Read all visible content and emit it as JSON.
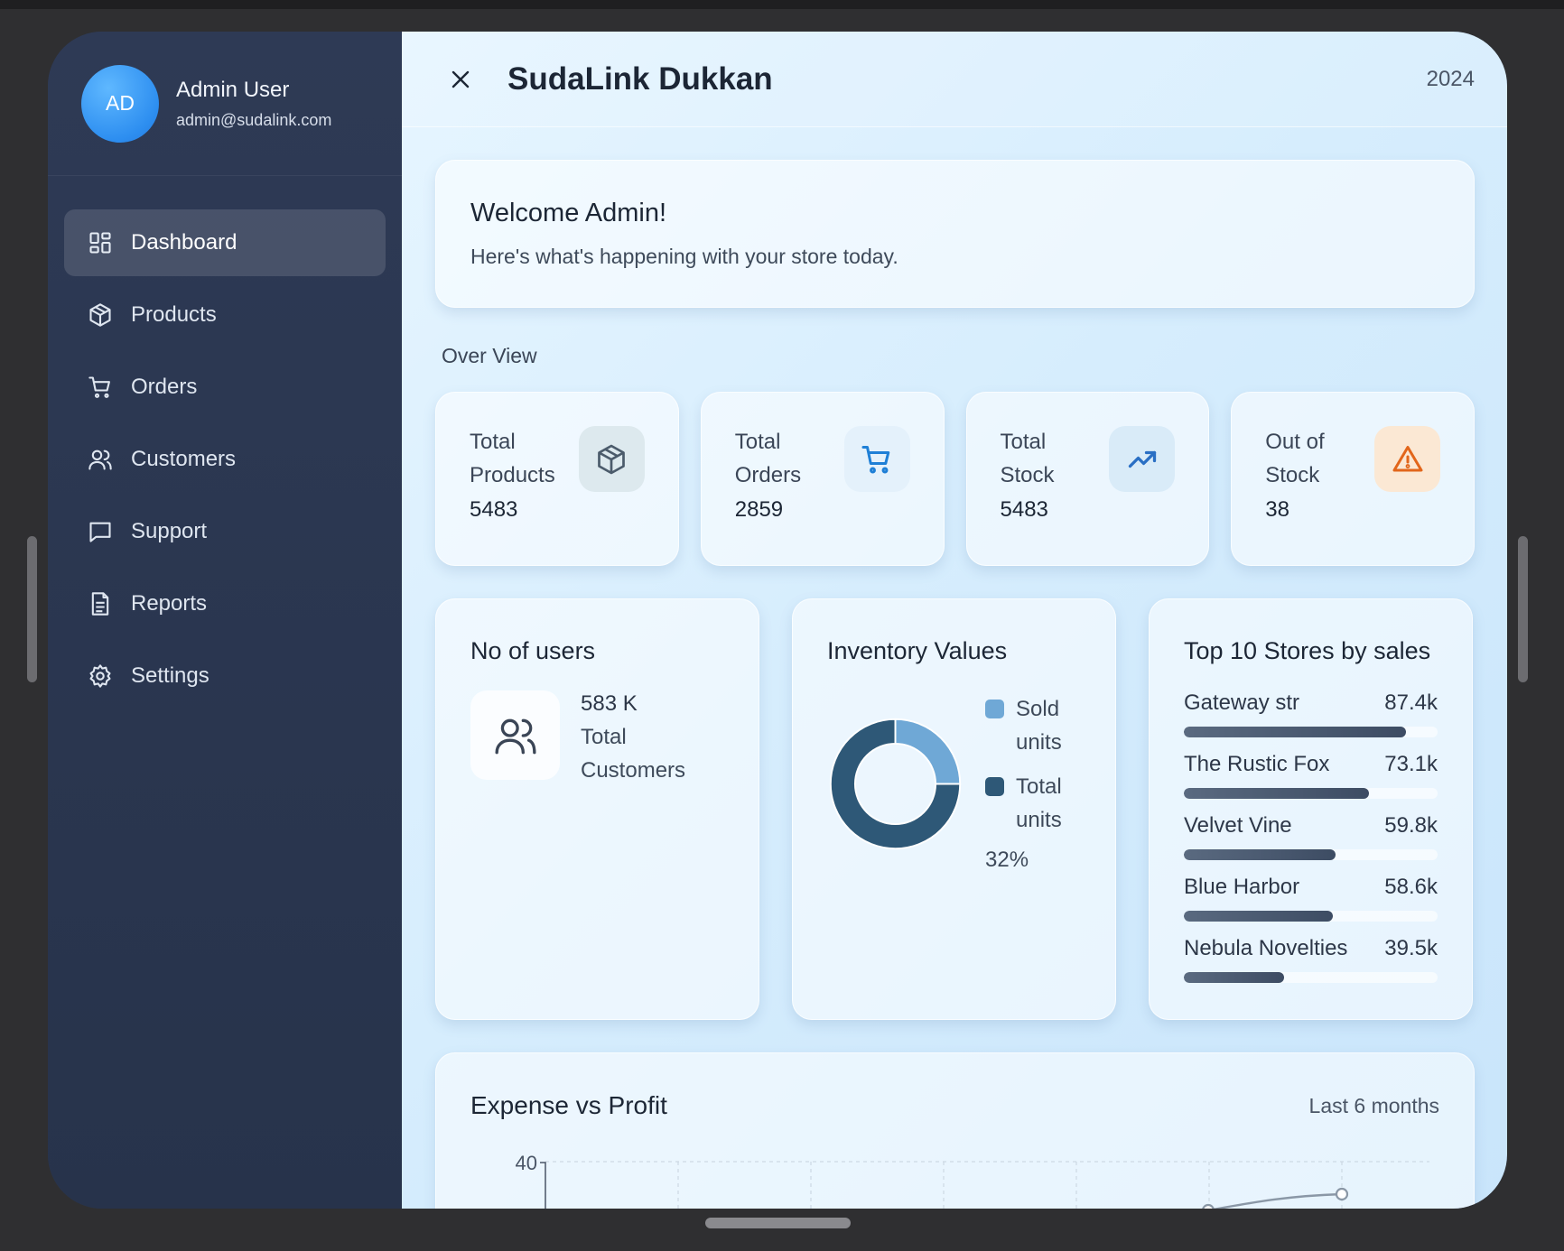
{
  "profile": {
    "initials": "AD",
    "name": "Admin User",
    "email": "admin@sudalink.com"
  },
  "nav": [
    {
      "label": "Dashboard",
      "icon": "dashboard-icon",
      "active": true
    },
    {
      "label": "Products",
      "icon": "box-icon"
    },
    {
      "label": "Orders",
      "icon": "cart-icon"
    },
    {
      "label": "Customers",
      "icon": "users-icon"
    },
    {
      "label": "Support",
      "icon": "message-icon"
    },
    {
      "label": "Reports",
      "icon": "document-icon"
    },
    {
      "label": "Settings",
      "icon": "gear-icon"
    }
  ],
  "header": {
    "title": "SudaLink Dukkan",
    "year": "2024"
  },
  "welcome": {
    "title": "Welcome Admin!",
    "subtitle": "Here's what's happening with your store today."
  },
  "overview": {
    "label": "Over View",
    "stats": [
      {
        "label": "Total Products",
        "value": "5483",
        "icon": "box-icon",
        "icon_bg": "#dde9ee",
        "icon_color": "#4b5b6b"
      },
      {
        "label": "Total Orders",
        "value": "2859",
        "icon": "cart-icon",
        "icon_bg": "#e4f1fb",
        "icon_color": "#1e7fd6"
      },
      {
        "label": "Total Stock",
        "value": "5483",
        "icon": "trending-up-icon",
        "icon_bg": "#d9ebf8",
        "icon_color": "#2a6fc4"
      },
      {
        "label": "Out of Stock",
        "value": "38",
        "icon": "warning-icon",
        "icon_bg": "#fbe8d4",
        "icon_color": "#e2661b"
      }
    ]
  },
  "users": {
    "title": "No of users",
    "value": "583 K",
    "label": "Total Customers"
  },
  "inventory": {
    "title": "Inventory Values",
    "legend": [
      {
        "label": "Sold units",
        "color": "#6fa8d6"
      },
      {
        "label": "Total units",
        "color": "#2e5877"
      }
    ],
    "percent": "32%",
    "sold_fraction": 0.25
  },
  "stores": {
    "title": "Top 10 Stores by sales",
    "items": [
      {
        "name": "Gateway str",
        "value": "87.4k",
        "fraction": 0.874
      },
      {
        "name": "The Rustic Fox",
        "value": "73.1k",
        "fraction": 0.731
      },
      {
        "name": "Velvet Vine",
        "value": "59.8k",
        "fraction": 0.598
      },
      {
        "name": "Blue Harbor",
        "value": "58.6k",
        "fraction": 0.586
      },
      {
        "name": "Nebula Novelties",
        "value": "39.5k",
        "fraction": 0.395
      }
    ]
  },
  "expense_chart": {
    "title": "Expense vs Profit",
    "range": "Last 6 months",
    "y_tick": "40"
  }
}
